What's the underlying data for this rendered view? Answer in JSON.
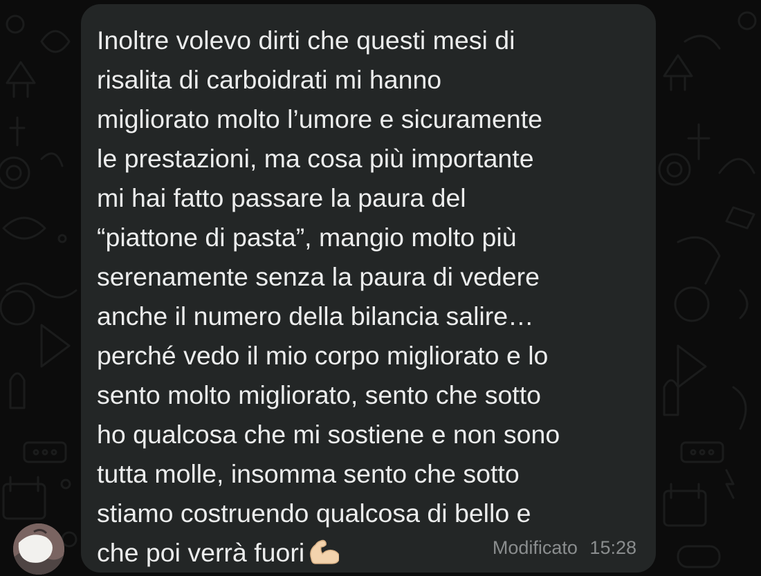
{
  "message": {
    "lines": [
      "Inoltre volevo dirti che questi mesi di",
      "risalita di carboidrati mi hanno",
      "migliorato molto l’umore e sicuramente",
      "le prestazioni, ma cosa più importante",
      "mi hai fatto passare la paura del",
      "“piattone di pasta”, mangio molto più",
      "serenamente senza la paura di vedere",
      "anche il numero della bilancia salire…",
      "perché vedo il mio corpo migliorato e lo",
      "sento molto migliorato, sento che sotto",
      "ho qualcosa che mi sostiene e non sono",
      "tutta molle, insomma sento che sotto",
      "stiamo costruendo qualcosa di bello e",
      "che poi verrà fuori"
    ],
    "emoji": "flexed-biceps-icon",
    "edited_label": "Modificato",
    "time": "15:28"
  },
  "avatar": {
    "icon": "avatar"
  },
  "colors": {
    "background": "#0c0c0c",
    "bubble": "#232626",
    "text": "#eceded",
    "meta": "#8a8d8e"
  }
}
